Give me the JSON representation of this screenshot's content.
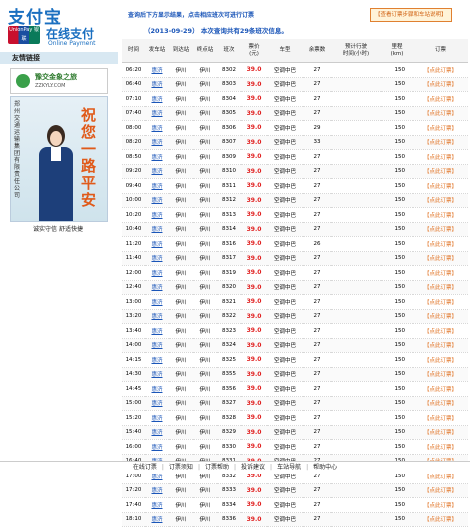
{
  "logo": {
    "main": "支付宝",
    "unionpay": "UnionPay 银联",
    "online": "在线支付",
    "payment": "Online Payment"
  },
  "sidebar": {
    "friend_links": "友情链接",
    "ad1": {
      "title": "豫交金象之旅",
      "url": "ZZKYLY.COM"
    },
    "ad2": {
      "org": "郑州交通运输集团有限责任公司",
      "slogan": "祝您一路平安"
    },
    "caption": "诚实守信  舒适快捷"
  },
  "top": {
    "line1": "查询后下方显示结果，点击相应班次可进行订票",
    "button": "【查看订票步骤和车站说明】",
    "line2": "（2013-09-29） 本次查询共有29条班次信息。"
  },
  "table": {
    "headers": [
      "时间",
      "发车站",
      "到达站",
      "终点站",
      "班次",
      "票价\n(元)",
      "车型",
      "余票数",
      "预计行驶\n时间(小时)",
      "里程\n(km)",
      "订票"
    ],
    "rows": [
      [
        "06:20",
        "惠济",
        "伊川",
        "伊川",
        "8302",
        "39.0",
        "空调中巴",
        "27",
        "",
        "150",
        "【点此订票】"
      ],
      [
        "06:40",
        "惠济",
        "伊川",
        "伊川",
        "8303",
        "39.0",
        "空调中巴",
        "27",
        "",
        "150",
        "【点此订票】"
      ],
      [
        "07:10",
        "惠济",
        "伊川",
        "伊川",
        "8304",
        "39.0",
        "空调中巴",
        "27",
        "",
        "150",
        "【点此订票】"
      ],
      [
        "07:40",
        "惠济",
        "伊川",
        "伊川",
        "8305",
        "39.0",
        "空调中巴",
        "27",
        "",
        "150",
        "【点此订票】"
      ],
      [
        "08:00",
        "惠济",
        "伊川",
        "伊川",
        "8306",
        "39.0",
        "空调中巴",
        "29",
        "",
        "150",
        "【点此订票】"
      ],
      [
        "08:20",
        "惠济",
        "伊川",
        "伊川",
        "8307",
        "39.0",
        "空调中巴",
        "33",
        "",
        "150",
        "【点此订票】"
      ],
      [
        "08:50",
        "惠济",
        "伊川",
        "伊川",
        "8309",
        "39.0",
        "空调中巴",
        "27",
        "",
        "150",
        "【点此订票】"
      ],
      [
        "09:20",
        "惠济",
        "伊川",
        "伊川",
        "8310",
        "39.0",
        "空调中巴",
        "27",
        "",
        "150",
        "【点此订票】"
      ],
      [
        "09:40",
        "惠济",
        "伊川",
        "伊川",
        "8311",
        "39.0",
        "空调中巴",
        "27",
        "",
        "150",
        "【点此订票】"
      ],
      [
        "10:00",
        "惠济",
        "伊川",
        "伊川",
        "8312",
        "39.0",
        "空调中巴",
        "27",
        "",
        "150",
        "【点此订票】"
      ],
      [
        "10:20",
        "惠济",
        "伊川",
        "伊川",
        "8313",
        "39.0",
        "空调中巴",
        "27",
        "",
        "150",
        "【点此订票】"
      ],
      [
        "10:40",
        "惠济",
        "伊川",
        "伊川",
        "8314",
        "39.0",
        "空调中巴",
        "27",
        "",
        "150",
        "【点此订票】"
      ],
      [
        "11:20",
        "惠济",
        "伊川",
        "伊川",
        "8316",
        "39.0",
        "空调中巴",
        "26",
        "",
        "150",
        "【点此订票】"
      ],
      [
        "11:40",
        "惠济",
        "伊川",
        "伊川",
        "8317",
        "39.0",
        "空调中巴",
        "27",
        "",
        "150",
        "【点此订票】"
      ],
      [
        "12:00",
        "惠济",
        "伊川",
        "伊川",
        "8319",
        "39.0",
        "空调中巴",
        "27",
        "",
        "150",
        "【点此订票】"
      ],
      [
        "12:40",
        "惠济",
        "伊川",
        "伊川",
        "8320",
        "39.0",
        "空调中巴",
        "27",
        "",
        "150",
        "【点此订票】"
      ],
      [
        "13:00",
        "惠济",
        "伊川",
        "伊川",
        "8321",
        "39.0",
        "空调中巴",
        "27",
        "",
        "150",
        "【点此订票】"
      ],
      [
        "13:20",
        "惠济",
        "伊川",
        "伊川",
        "8322",
        "39.0",
        "空调中巴",
        "27",
        "",
        "150",
        "【点此订票】"
      ],
      [
        "13:40",
        "惠济",
        "伊川",
        "伊川",
        "8323",
        "39.0",
        "空调中巴",
        "27",
        "",
        "150",
        "【点此订票】"
      ],
      [
        "14:00",
        "惠济",
        "伊川",
        "伊川",
        "8324",
        "39.0",
        "空调中巴",
        "27",
        "",
        "150",
        "【点此订票】"
      ],
      [
        "14:15",
        "惠济",
        "伊川",
        "伊川",
        "8325",
        "39.0",
        "空调中巴",
        "27",
        "",
        "150",
        "【点此订票】"
      ],
      [
        "14:30",
        "惠济",
        "伊川",
        "伊川",
        "8355",
        "39.0",
        "空调中巴",
        "27",
        "",
        "150",
        "【点此订票】"
      ],
      [
        "14:45",
        "惠济",
        "伊川",
        "伊川",
        "8356",
        "39.0",
        "空调中巴",
        "27",
        "",
        "150",
        "【点此订票】"
      ],
      [
        "15:00",
        "惠济",
        "伊川",
        "伊川",
        "8327",
        "39.0",
        "空调中巴",
        "27",
        "",
        "150",
        "【点此订票】"
      ],
      [
        "15:20",
        "惠济",
        "伊川",
        "伊川",
        "8328",
        "39.0",
        "空调中巴",
        "27",
        "",
        "150",
        "【点此订票】"
      ],
      [
        "15:40",
        "惠济",
        "伊川",
        "伊川",
        "8329",
        "39.0",
        "空调中巴",
        "27",
        "",
        "150",
        "【点此订票】"
      ],
      [
        "16:00",
        "惠济",
        "伊川",
        "伊川",
        "8330",
        "39.0",
        "空调中巴",
        "27",
        "",
        "150",
        "【点此订票】"
      ],
      [
        "16:40",
        "惠济",
        "伊川",
        "伊川",
        "8331",
        "39.0",
        "空调中巴",
        "27",
        "",
        "150",
        "【点此订票】"
      ],
      [
        "17:00",
        "惠济",
        "伊川",
        "伊川",
        "8332",
        "39.0",
        "空调中巴",
        "27",
        "",
        "150",
        "【点此订票】"
      ],
      [
        "17:20",
        "惠济",
        "伊川",
        "伊川",
        "8333",
        "39.0",
        "空调中巴",
        "27",
        "",
        "150",
        "【点此订票】"
      ],
      [
        "17:40",
        "惠济",
        "伊川",
        "伊川",
        "8334",
        "39.0",
        "空调中巴",
        "27",
        "",
        "150",
        "【点此订票】"
      ],
      [
        "18:10",
        "惠济",
        "伊川",
        "伊川",
        "8336",
        "39.0",
        "空调中巴",
        "27",
        "",
        "150",
        "【点此订票】"
      ]
    ]
  },
  "footer": [
    "在线订票",
    "订票须知",
    "订票帮助",
    "投诉建议",
    "车站导航",
    "帮助中心"
  ]
}
